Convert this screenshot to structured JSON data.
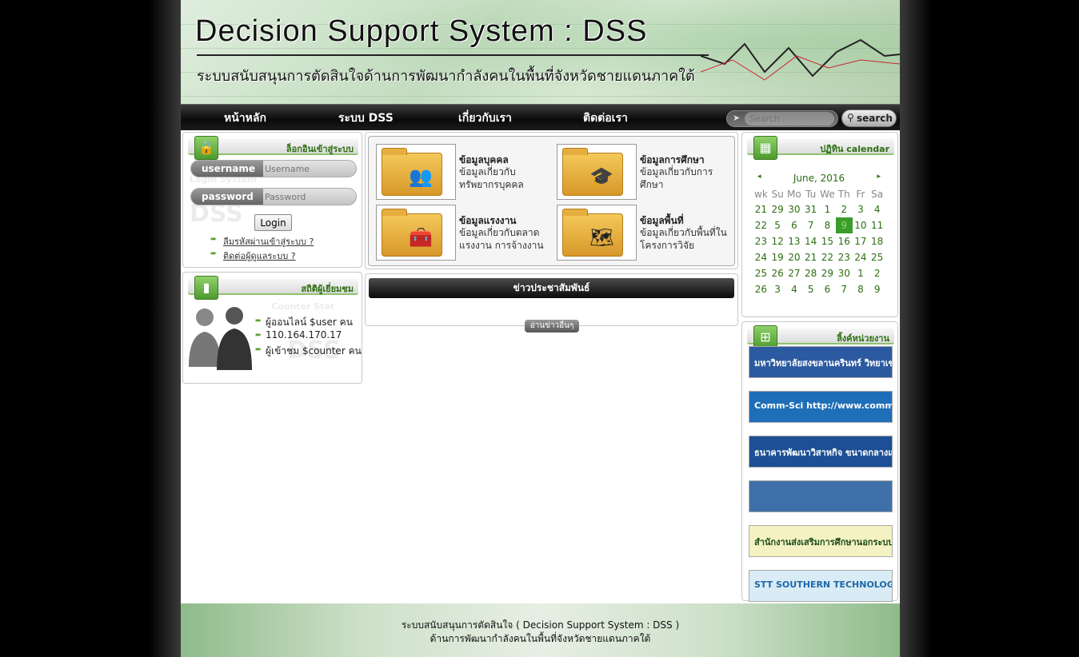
{
  "header": {
    "title": "Decision Support System : DSS",
    "subtitle": "ระบบสนับสนุนการตัดสินใจด้านการพัฒนากำลังคนในพื้นที่จังหวัดชายแดนภาคใต้"
  },
  "nav": {
    "items": [
      "หน้าหลัก",
      "ระบบ DSS",
      "เกี่ยวกับเรา",
      "ติดต่อเรา"
    ],
    "search_placeholder": "Search",
    "search_button": "search"
  },
  "login": {
    "heading": "ล็อกอินเข้าสู่ระบบ",
    "username_label": "username",
    "username_placeholder": "Username",
    "password_label": "password",
    "password_placeholder": "Password",
    "button": "Login",
    "forgot_link": "ลืมรหัสผ่านเข้าสู่ระบบ ?",
    "contact_link": "ติดต่อผู้ดูแลระบบ ?",
    "watermark": "Login System"
  },
  "stats": {
    "heading": "สถิติผู้เยี่ยมชม",
    "watermark": "Counter Stat",
    "online": "ผู้ออนไลน์ $user คน",
    "ip": "110.164.170.17",
    "visitors": "ผู้เข้าชม $counter คน"
  },
  "features": [
    {
      "title": "ข้อมูลบุคคล",
      "desc": "ข้อมูลเกี่ยวกับทรัพยากรบุคคล",
      "icon": "people-icon",
      "glyph": "👥"
    },
    {
      "title": "ข้อมูลการศึกษา",
      "desc": "ข้อมูลเกี่ยวกับการศึกษา",
      "icon": "graduation-cap-icon",
      "glyph": "🎓"
    },
    {
      "title": "ข้อมูลแรงงาน",
      "desc": "ข้อมูลเกี่ยวกับตลาดแรงงาน การจ้างงาน",
      "icon": "toolbox-icon",
      "glyph": "🧰"
    },
    {
      "title": "ข้อมูลพื้นที่",
      "desc": "ข้อมูลเกี่ยวกับพื้นที่ในโครงการวิจัย",
      "icon": "map-icon",
      "glyph": "🗺"
    }
  ],
  "news": {
    "heading": "ข่าวประชาสัมพันธ์",
    "read_more": "อ่านข่าวอื่นๆ"
  },
  "calendar": {
    "heading": "ปฏิทิน calendar",
    "prev": "◂",
    "next": "▸",
    "month_label": "June, 2016",
    "columns": [
      "wk",
      "Su",
      "Mo",
      "Tu",
      "We",
      "Th",
      "Fr",
      "Sa"
    ],
    "rows": [
      [
        "21",
        "29",
        "30",
        "31",
        "1",
        "2",
        "3",
        "4"
      ],
      [
        "22",
        "5",
        "6",
        "7",
        "8",
        "9",
        "10",
        "11"
      ],
      [
        "23",
        "12",
        "13",
        "14",
        "15",
        "16",
        "17",
        "18"
      ],
      [
        "24",
        "19",
        "20",
        "21",
        "22",
        "23",
        "24",
        "25"
      ],
      [
        "25",
        "26",
        "27",
        "28",
        "29",
        "30",
        "1",
        "2"
      ],
      [
        "26",
        "3",
        "4",
        "5",
        "6",
        "7",
        "8",
        "9"
      ]
    ],
    "today": "9"
  },
  "links": {
    "heading": "ลิ้งค์หน่วยงาน",
    "banners": [
      {
        "text": "มหาวิทยาลัยสงขลานครินทร์ วิทยาเขตปัตตานี",
        "bg": "#2c5aa0",
        "fg": "#ffffff"
      },
      {
        "text": "Comm-Sci http://www.comm-sci.pn.psu.ac.th",
        "bg": "#1f6fb8",
        "fg": "#ffffff"
      },
      {
        "text": "ธนาคารพัฒนาวิสาหกิจ ขนาดกลางและขนาดย่อมแห่งประเทศไทย",
        "bg": "#1c4f95",
        "fg": "#ffffff"
      },
      {
        "text": "",
        "bg": "#3f6fa8",
        "fg": "#ffffff"
      },
      {
        "text": "สำนักงานส่งเสริมการศึกษานอกระบบและการศึกษาตามอัธยาศัยจังหวัดปัตตานี",
        "bg": "#f4f1c2",
        "fg": "#1b4c1b"
      },
      {
        "text": "STT SOUTHERN TECHNOLOGY",
        "bg": "#d9ecf5",
        "fg": "#1c67a8"
      }
    ]
  },
  "footer": {
    "line1": "ระบบสนับสนุนการตัดสินใจ ( Decision Support System : DSS )",
    "line2": "ด้านการพัฒนากำลังคนในพื้นที่จังหวัดชายแดนภาคใต้"
  },
  "colors": {
    "accent_green": "#3a9c2a",
    "nav_bg": "#111111"
  }
}
